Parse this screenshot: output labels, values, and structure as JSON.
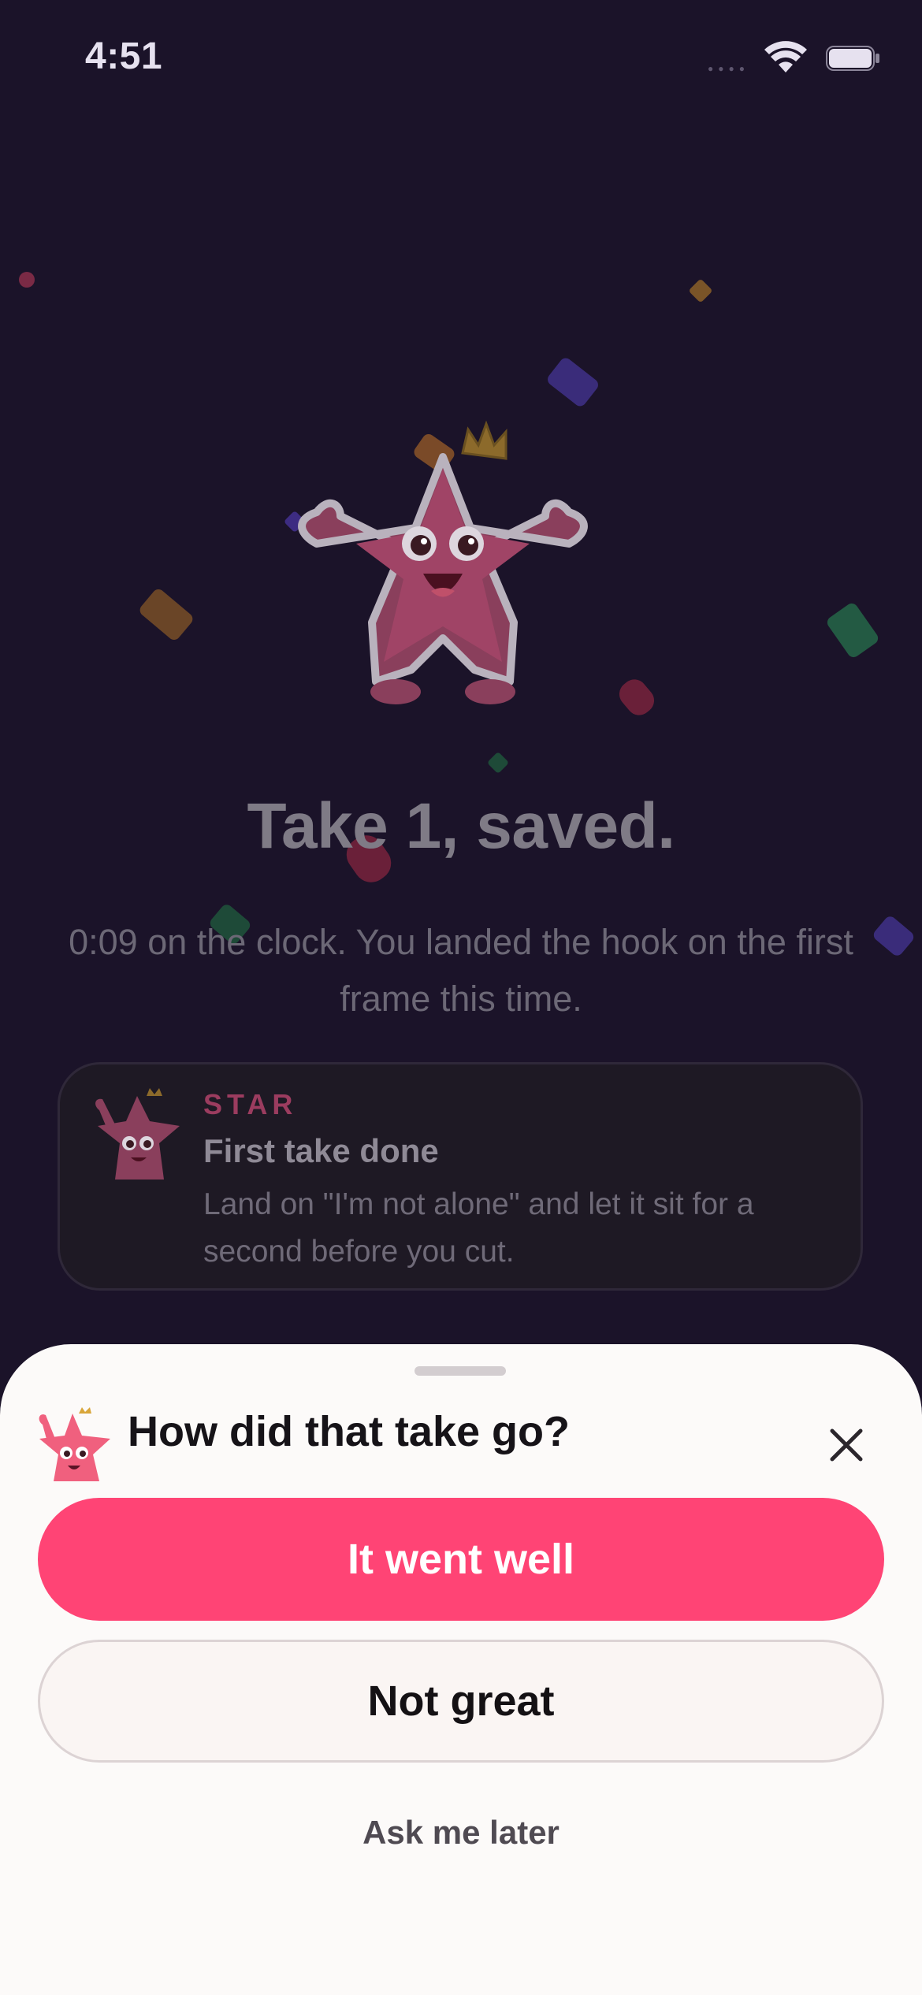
{
  "status_bar": {
    "time": "4:51",
    "icons": [
      "cellular-icon",
      "wifi-icon",
      "battery-icon"
    ]
  },
  "celebration": {
    "title": "Take 1, saved.",
    "subtitle": "0:09 on the clock. You landed the hook on the first frame this time."
  },
  "mascot_card": {
    "label": "STAR",
    "heading": "First take done",
    "body": "Land on \"I'm not alone\" and let it sit for a second before you cut."
  },
  "sheet": {
    "title": "How did that take go?",
    "primary_button": "It went well",
    "secondary_button": "Not great",
    "later_link": "Ask me later"
  },
  "colors": {
    "background": "#1b1329",
    "accent": "#ff4475",
    "sheet": "#fcfaf9"
  }
}
